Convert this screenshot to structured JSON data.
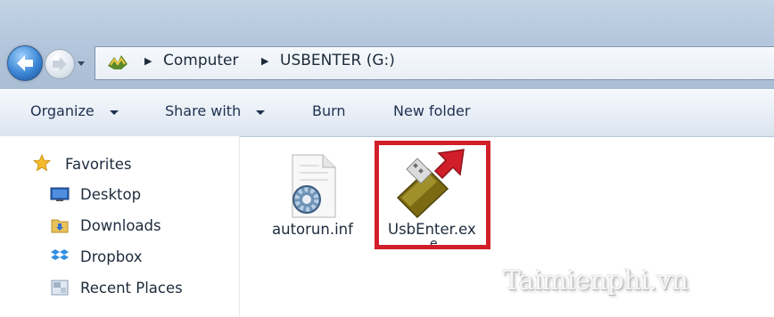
{
  "address": {
    "crumbs": [
      "Computer",
      "USBENTER (G:)"
    ],
    "separator": "▶"
  },
  "commands": {
    "organize": "Organize",
    "share_with": "Share with",
    "burn": "Burn",
    "new_folder": "New folder"
  },
  "nav": {
    "favorites": "Favorites",
    "items": [
      "Desktop",
      "Downloads",
      "Dropbox",
      "Recent Places"
    ]
  },
  "files": [
    {
      "name": "autorun.inf",
      "icon": "settings-file-icon"
    },
    {
      "name": "UsbEnter.ex",
      "icon": "usb-drive-icon",
      "overflow_char": "e"
    }
  ],
  "watermark": "Taimienphi.vn",
  "colors": {
    "highlight": "#d11f2a",
    "arrow": "#d11f2a"
  }
}
